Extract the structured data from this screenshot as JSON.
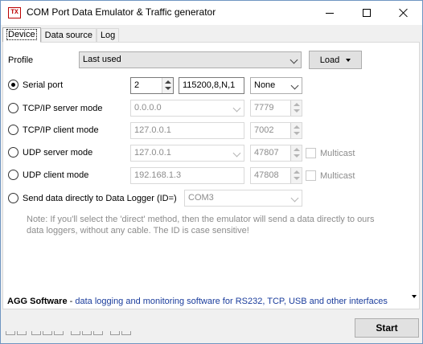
{
  "window": {
    "title": "COM Port Data Emulator & Traffic generator",
    "icon_text": "TX"
  },
  "tabs": [
    {
      "label": "Device",
      "active": true
    },
    {
      "label": "Data source",
      "active": false
    },
    {
      "label": "Log",
      "active": false
    }
  ],
  "profile": {
    "label": "Profile",
    "value": "Last used",
    "load_label": "Load"
  },
  "modes": {
    "serial": {
      "label": "Serial port",
      "checked": true,
      "port": "2",
      "settings": "115200,8,N,1",
      "flow": "None"
    },
    "tcp_server": {
      "label": "TCP/IP server mode",
      "checked": false,
      "address": "0.0.0.0",
      "port": "7779"
    },
    "tcp_client": {
      "label": "TCP/IP client mode",
      "checked": false,
      "address": "127.0.0.1",
      "port": "7002"
    },
    "udp_server": {
      "label": "UDP server mode",
      "checked": false,
      "address": "127.0.0.1",
      "port": "47807",
      "multicast_label": "Multicast"
    },
    "udp_client": {
      "label": "UDP client mode",
      "checked": false,
      "address": "192.168.1.3",
      "port": "47808",
      "multicast_label": "Multicast"
    },
    "direct": {
      "label": "Send data directly to Data Logger (ID=)",
      "checked": false,
      "value": "COM3"
    }
  },
  "note": "Note: If you'll select the 'direct' method, then the emulator will send a data directly to ours data loggers, without any cable. The ID is case sensitive!",
  "footer": {
    "brand": "AGG Software",
    "separator": " - ",
    "link": "data logging and monitoring software for RS232, TCP, USB and other interfaces"
  },
  "start_label": "Start"
}
